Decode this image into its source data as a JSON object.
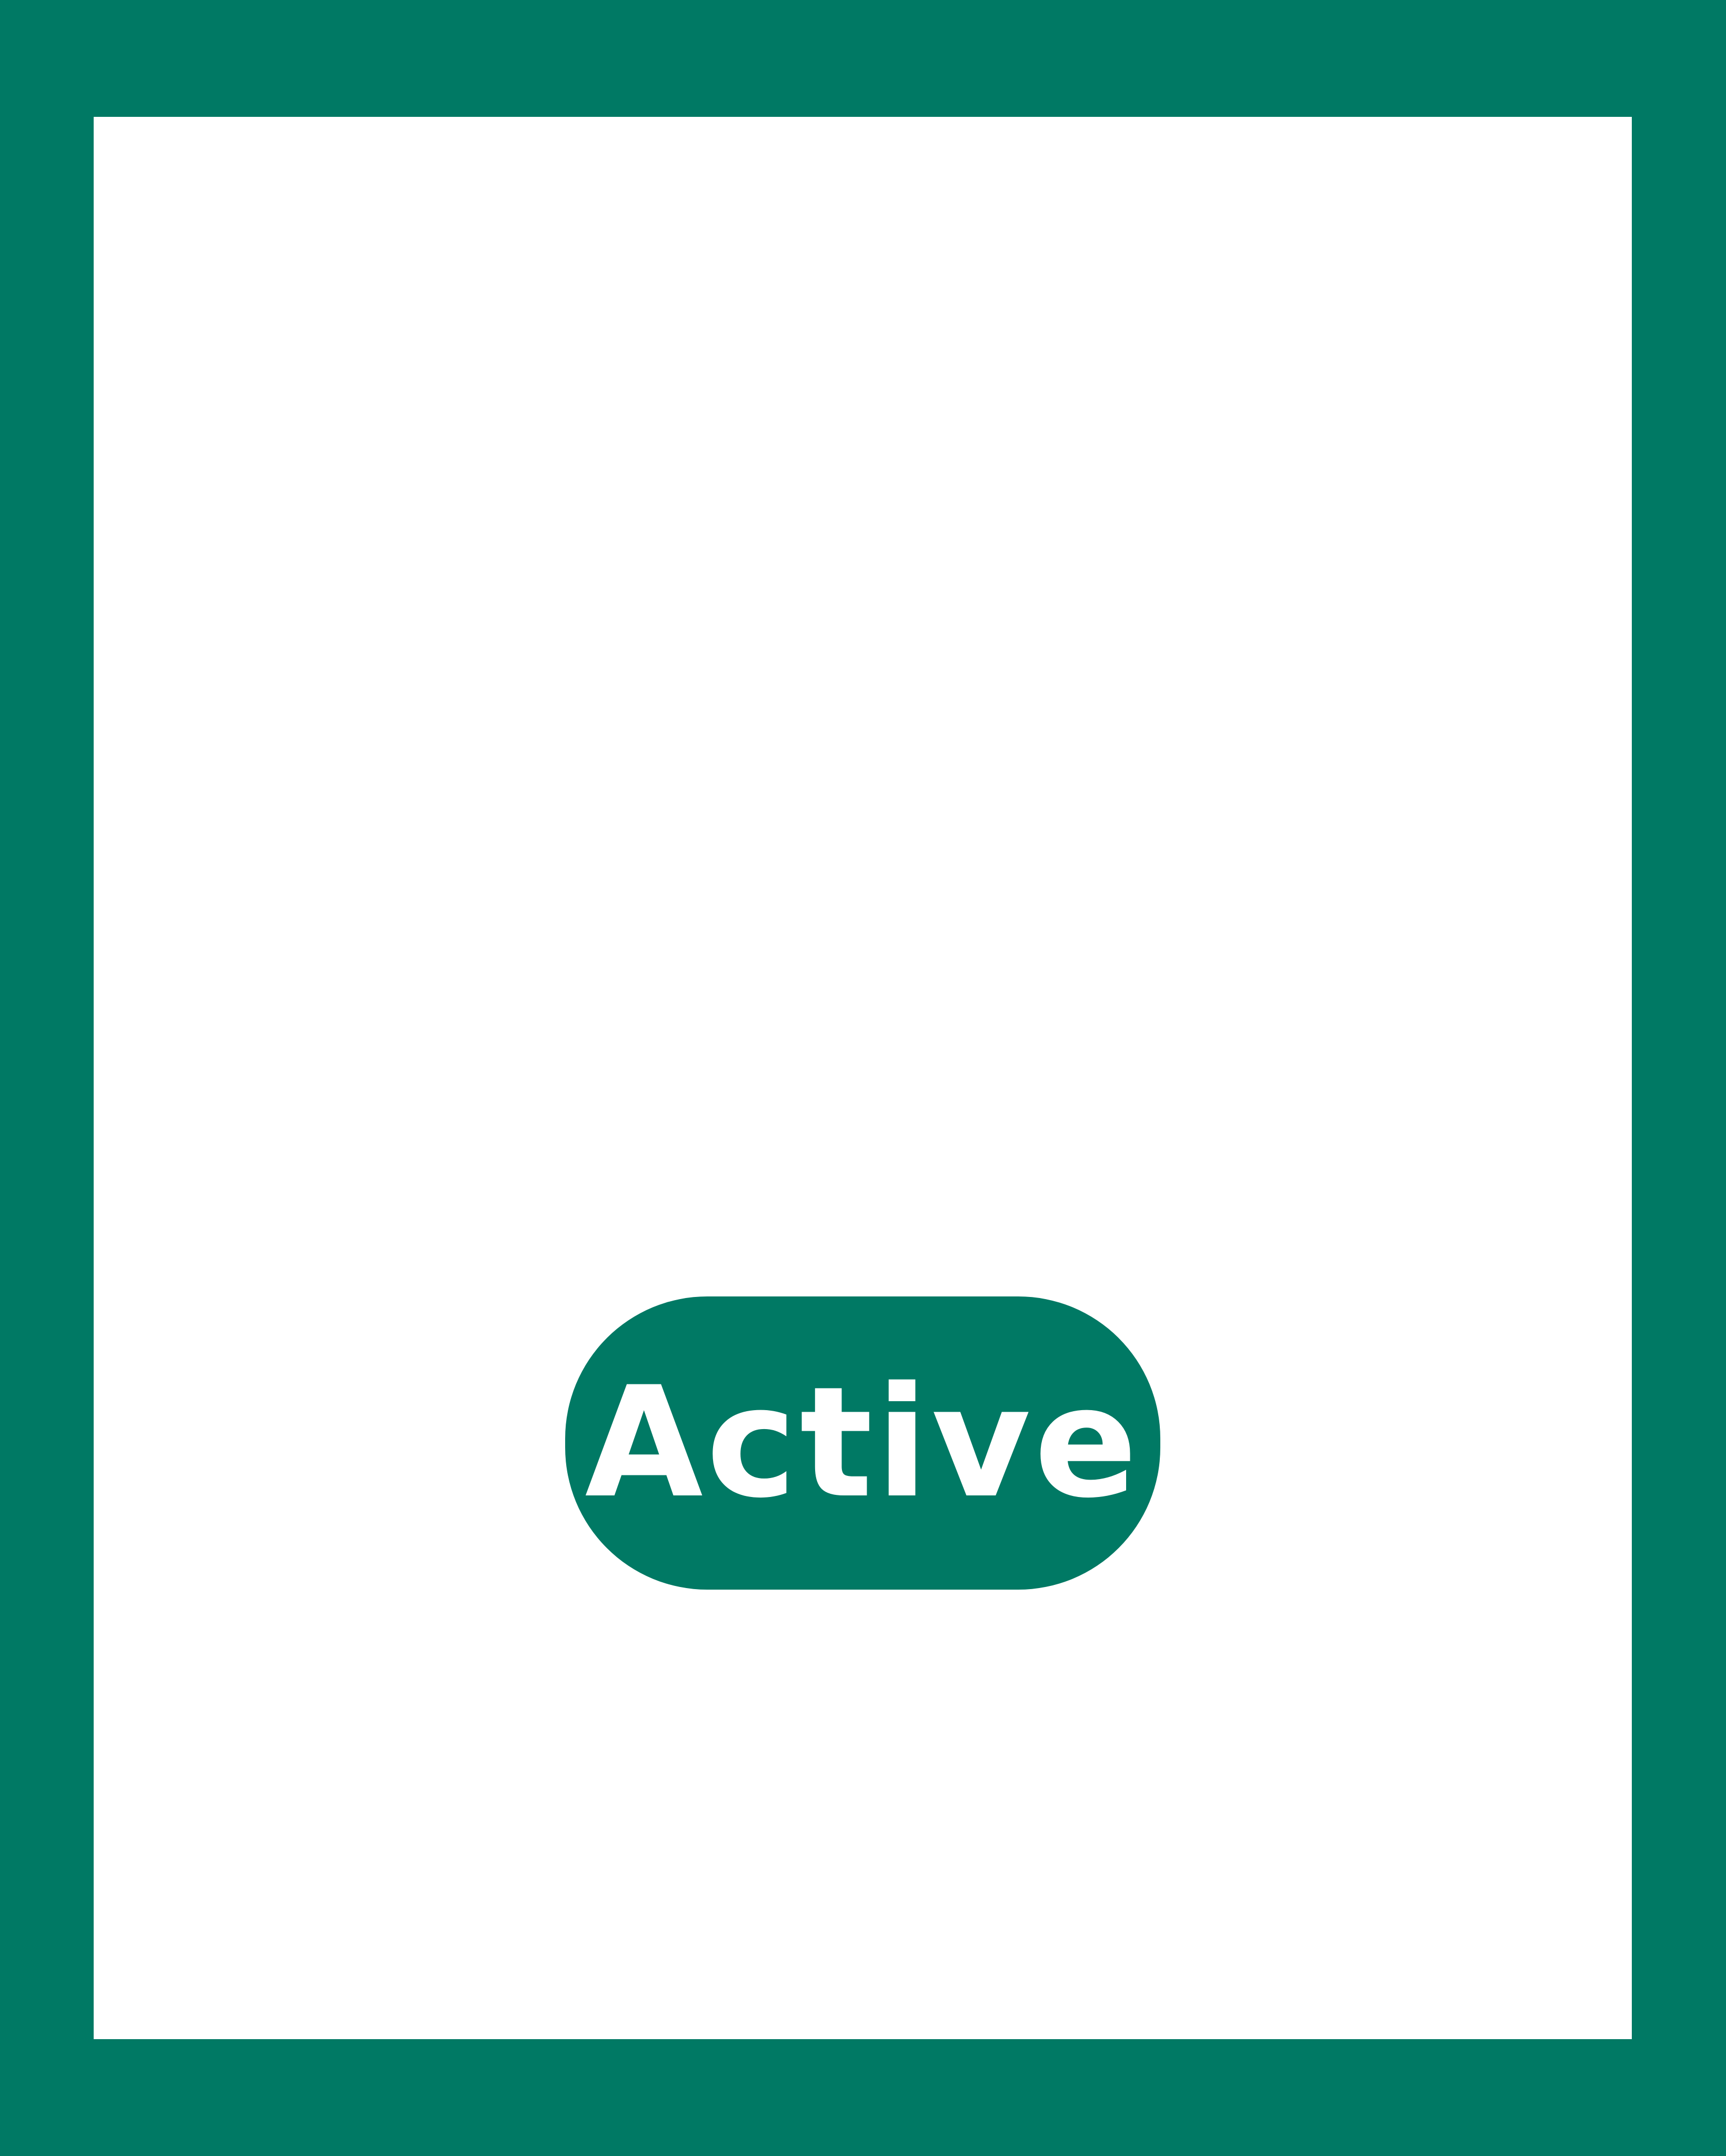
{
  "colors": {
    "accent": "#007964",
    "panel_background": "#ffffff",
    "badge_text": "#ffffff"
  },
  "status_badge": {
    "label": "Active"
  }
}
